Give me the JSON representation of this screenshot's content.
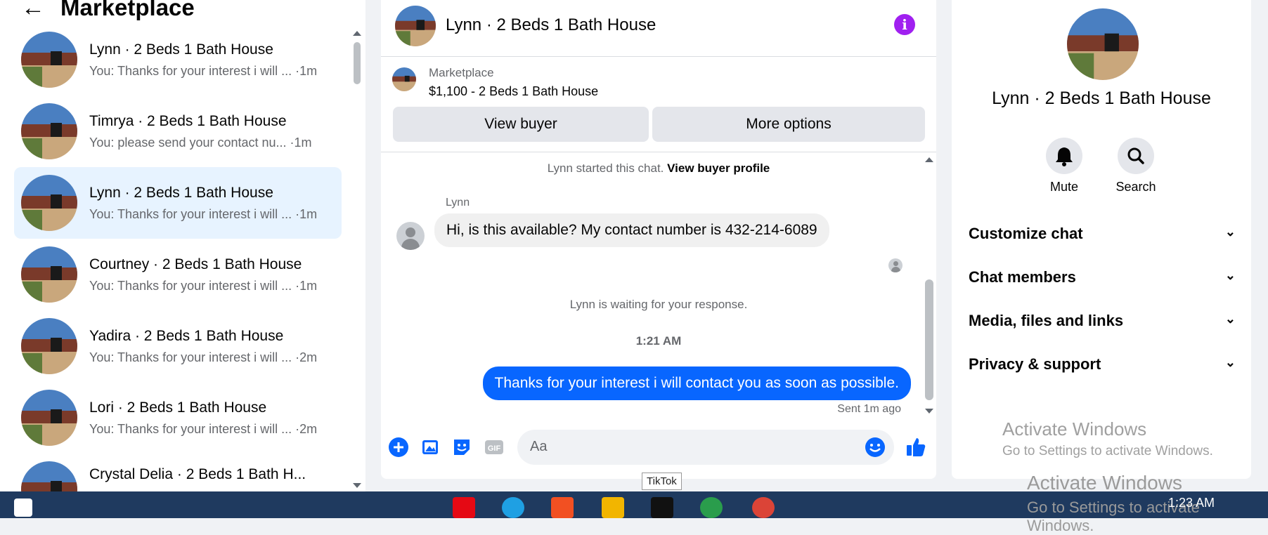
{
  "sidebar": {
    "back_icon": "arrow-left-icon",
    "title": "Marketplace",
    "conversations": [
      {
        "name": "Lynn · 2 Beds 1 Bath House",
        "preview": "You: Thanks for your interest i will ... ·1m"
      },
      {
        "name": "Timrya · 2 Beds 1 Bath House",
        "preview": "You: please send your contact nu... ·1m"
      },
      {
        "name": "Lynn · 2 Beds 1 Bath House",
        "preview": "You: Thanks for your interest i will ... ·1m"
      },
      {
        "name": "Courtney · 2 Beds 1 Bath House",
        "preview": "You: Thanks for your interest i will ... ·1m"
      },
      {
        "name": "Yadira · 2 Beds 1 Bath House",
        "preview": "You: Thanks for your interest i will ... ·2m"
      },
      {
        "name": "Lori · 2 Beds 1 Bath House",
        "preview": "You: Thanks for your interest i will ... ·2m"
      },
      {
        "name": "Crystal Delia · 2 Beds 1 Bath H...",
        "preview": ""
      }
    ]
  },
  "chat": {
    "header_name": "Lynn · 2 Beds 1 Bath House",
    "info_icon": "info-icon",
    "marketplace_label": "Marketplace",
    "listing": "$1,100 - 2 Beds 1 Bath House",
    "view_buyer": "View buyer",
    "more_options": "More options",
    "started_text": "Lynn started this chat.",
    "view_profile": "View buyer profile",
    "sender": "Lynn",
    "incoming_message": "Hi, is this available? My contact number is 432-214-6089",
    "waiting": "Lynn is waiting for your response.",
    "time": "1:21 AM",
    "outgoing_message": "Thanks for your interest i will contact you as soon as possible.",
    "sent_status": "Sent 1m ago",
    "input_placeholder": "Aa"
  },
  "details": {
    "name": "Lynn · 2 Beds 1 Bath House",
    "mute": "Mute",
    "search": "Search",
    "sections": [
      "Customize chat",
      "Chat members",
      "Media, files and links",
      "Privacy & support"
    ]
  },
  "watermark": {
    "line1": "Activate Windows",
    "line2": "Go to Settings to activate Windows."
  },
  "taskbar": {
    "tooltip": "TikTok",
    "clock": "1:23 AM"
  },
  "colors": {
    "accent": "#0866ff",
    "info": "#a020f0",
    "active_row": "#e7f3ff"
  }
}
